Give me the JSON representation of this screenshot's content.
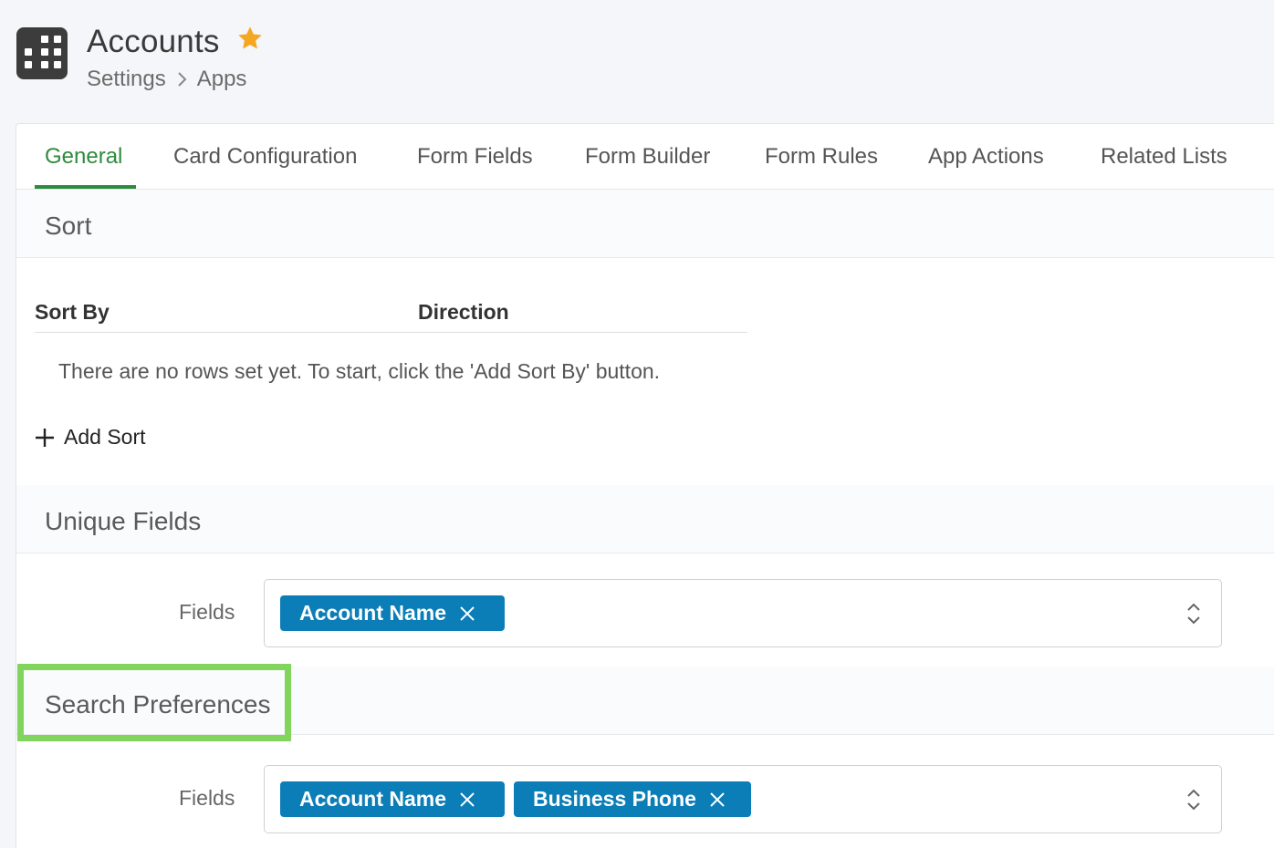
{
  "header": {
    "title": "Accounts",
    "breadcrumb": [
      "Settings",
      "Apps"
    ]
  },
  "tabs": [
    {
      "label": "General",
      "active": true
    },
    {
      "label": "Card Configuration"
    },
    {
      "label": "Form Fields"
    },
    {
      "label": "Form Builder"
    },
    {
      "label": "Form Rules"
    },
    {
      "label": "App Actions"
    },
    {
      "label": "Related Lists"
    }
  ],
  "sort": {
    "heading": "Sort",
    "columns": [
      "Sort By",
      "Direction"
    ],
    "empty_message": "There are no rows set yet. To start, click the 'Add Sort By' button.",
    "add_label": "Add Sort"
  },
  "unique_fields": {
    "heading": "Unique Fields",
    "label": "Fields",
    "chips": [
      "Account Name"
    ]
  },
  "search_preferences": {
    "heading": "Search Preferences",
    "label": "Fields",
    "chips": [
      "Account Name",
      "Business Phone"
    ]
  },
  "colors": {
    "accent_green": "#2e8b3d",
    "chip_blue": "#0b7db7",
    "highlight_green": "#82d55c",
    "star": "#f5a623"
  },
  "icons": [
    "apps-grid-icon",
    "favorite-star-icon",
    "chevron-right-icon",
    "plus-icon",
    "remove-x-icon",
    "select-updown-icon"
  ]
}
